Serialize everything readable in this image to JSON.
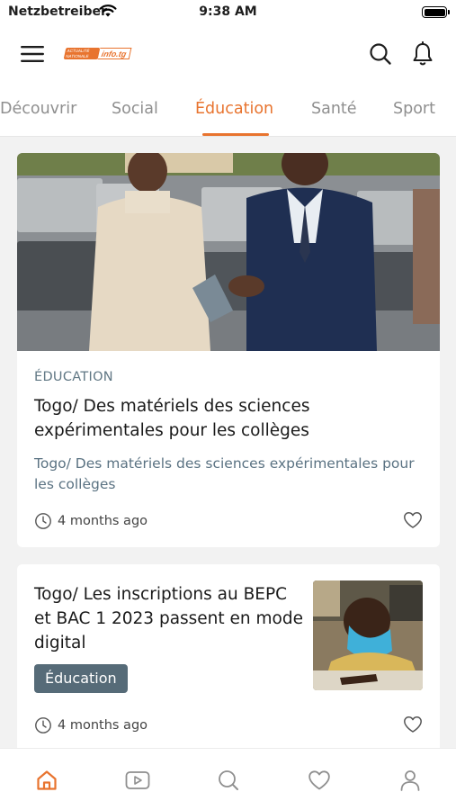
{
  "status_bar": {
    "carrier": "Netzbetreiber",
    "time": "9:38 AM"
  },
  "header": {
    "logo": {
      "tagline_line1": "ACTUALITÉ",
      "tagline_line2": "NATIONALE",
      "brand": "info.tg"
    }
  },
  "tabs": [
    {
      "label": "Découvrir",
      "active": false
    },
    {
      "label": "Social",
      "active": false
    },
    {
      "label": "Éducation",
      "active": true
    },
    {
      "label": "Santé",
      "active": false
    },
    {
      "label": "Sport",
      "active": false
    }
  ],
  "articles": [
    {
      "category": "ÉDUCATION",
      "title": "Togo/ Des matériels des sciences expérimentales pour les collèges",
      "subtitle": "Togo/ Des matériels des sciences expérimentales pour les collèges",
      "time": "4 months ago"
    },
    {
      "title": "Togo/ Les inscriptions au BEPC et BAC 1 2023 passent en mode digital",
      "badge": "Éducation",
      "time": "4 months ago"
    }
  ],
  "bottom_nav": [
    {
      "icon": "home-icon",
      "active": true
    },
    {
      "icon": "video-icon",
      "active": false
    },
    {
      "icon": "search-icon",
      "active": false
    },
    {
      "icon": "heart-icon",
      "active": false
    },
    {
      "icon": "profile-icon",
      "active": false
    }
  ],
  "colors": {
    "accent": "#e8742f",
    "muted": "#5a7282",
    "badge_bg": "#566b78"
  }
}
